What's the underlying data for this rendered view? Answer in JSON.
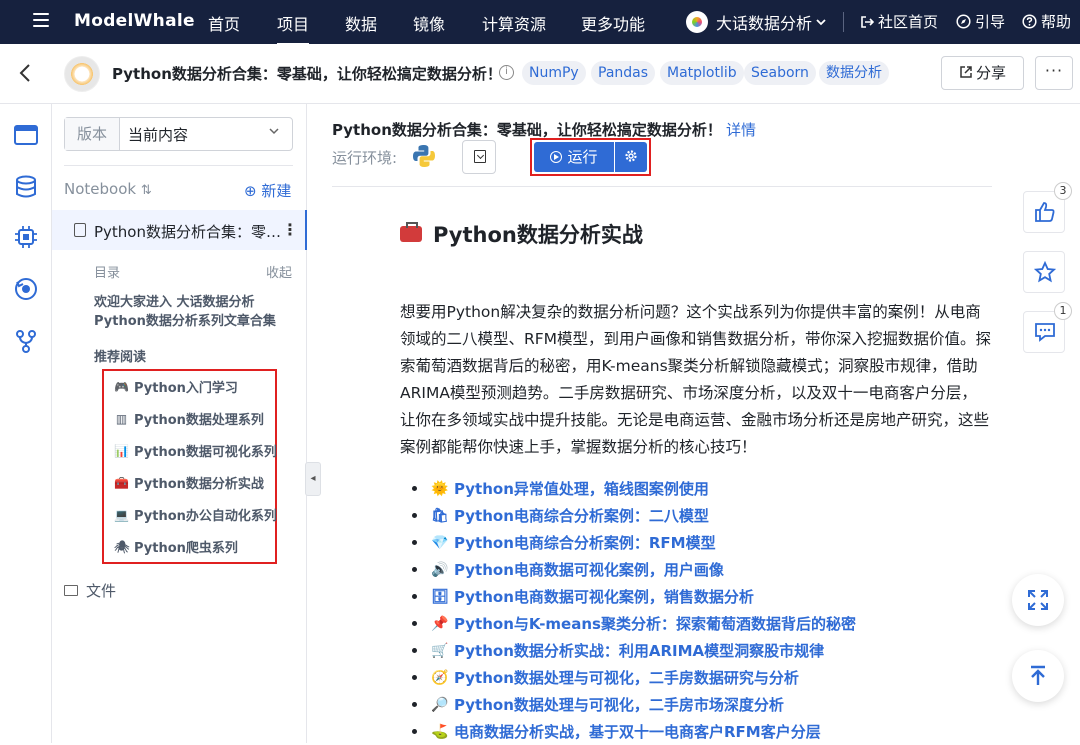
{
  "topnav": {
    "brand": "ModelWhale",
    "items": [
      "首页",
      "项目",
      "数据",
      "镜像",
      "计算资源",
      "更多功能"
    ],
    "workspace": "大话数据分析",
    "community": "社区首页",
    "guide": "引导",
    "help": "帮助"
  },
  "project": {
    "title": "Python数据分析合集：零基础，让你轻松搞定数据分析！",
    "tags": [
      "NumPy",
      "Pandas",
      "Matplotlib",
      "Seaborn",
      "数据分析"
    ],
    "share": "分享"
  },
  "sidebar": {
    "version_label": "版本",
    "version_value": "当前内容",
    "notebook_label": "Notebook",
    "new_label": "新建",
    "notebook_item": "Python数据分析合集：零…",
    "toc_label": "目录",
    "collapse_label": "收起",
    "welcome": "欢迎大家进入 大话数据分析 Python数据分析系列文章合集",
    "recommend_label": "推荐阅读",
    "recommend": [
      {
        "icon": "🎮",
        "label": "Python入门学习"
      },
      {
        "icon": "▥",
        "label": "Python数据处理系列"
      },
      {
        "icon": "📊",
        "label": "Python数据可视化系列"
      },
      {
        "icon": "🧰",
        "label": "Python数据分析实战"
      },
      {
        "icon": "💻",
        "label": "Python办公自动化系列"
      },
      {
        "icon": "🕷",
        "label": "Python爬虫系列"
      }
    ],
    "files_label": "文件"
  },
  "main": {
    "title": "Python数据分析合集：零基础，让你轻松搞定数据分析！",
    "detail": "详情",
    "env_label": "运行环境:",
    "run_label": "运行",
    "heading": "Python数据分析实战",
    "intro": "想要用Python解决复杂的数据分析问题？这个实战系列为你提供丰富的案例！从电商领域的二八模型、RFM模型，到用户画像和销售数据分析，带你深入挖掘数据价值。探索葡萄酒数据背后的秘密，用K-means聚类分析解锁隐藏模式；洞察股市规律，借助ARIMA模型预测趋势。二手房数据研究、市场深度分析，以及双十一电商客户分层，让你在多领域实战中提升技能。无论是电商运营、金融市场分析还是房地产研究，这些案例都能帮你快速上手，掌握数据分析的核心技巧！",
    "links": [
      {
        "icon": "🌞",
        "label": "Python异常值处理，箱线图案例使用"
      },
      {
        "icon": "🛍",
        "label": "Python电商综合分析案例：二八模型"
      },
      {
        "icon": "💎",
        "label": "Python电商综合分析案例：RFM模型"
      },
      {
        "icon": "🔊",
        "label": "Python电商数据可视化案例，用户画像"
      },
      {
        "icon": "🗄",
        "label": "Python电商数据可视化案例，销售数据分析"
      },
      {
        "icon": "📌",
        "label": "Python与K-means聚类分析：探索葡萄酒数据背后的秘密"
      },
      {
        "icon": "🛒",
        "label": "Python数据分析实战：利用ARIMA模型洞察股市规律"
      },
      {
        "icon": "🧭",
        "label": "Python数据处理与可视化，二手房数据研究与分析"
      },
      {
        "icon": "🔎",
        "label": "Python数据处理与可视化，二手房市场深度分析"
      },
      {
        "icon": "⛳",
        "label": "电商数据分析实战，基于双十一电商客户RFM客户分层"
      }
    ]
  },
  "floating": {
    "like_count": "3",
    "comment_count": "1"
  },
  "colors": {
    "nav_bg": "#16213e",
    "accent": "#2f6bd5",
    "highlight": "#e02020"
  }
}
